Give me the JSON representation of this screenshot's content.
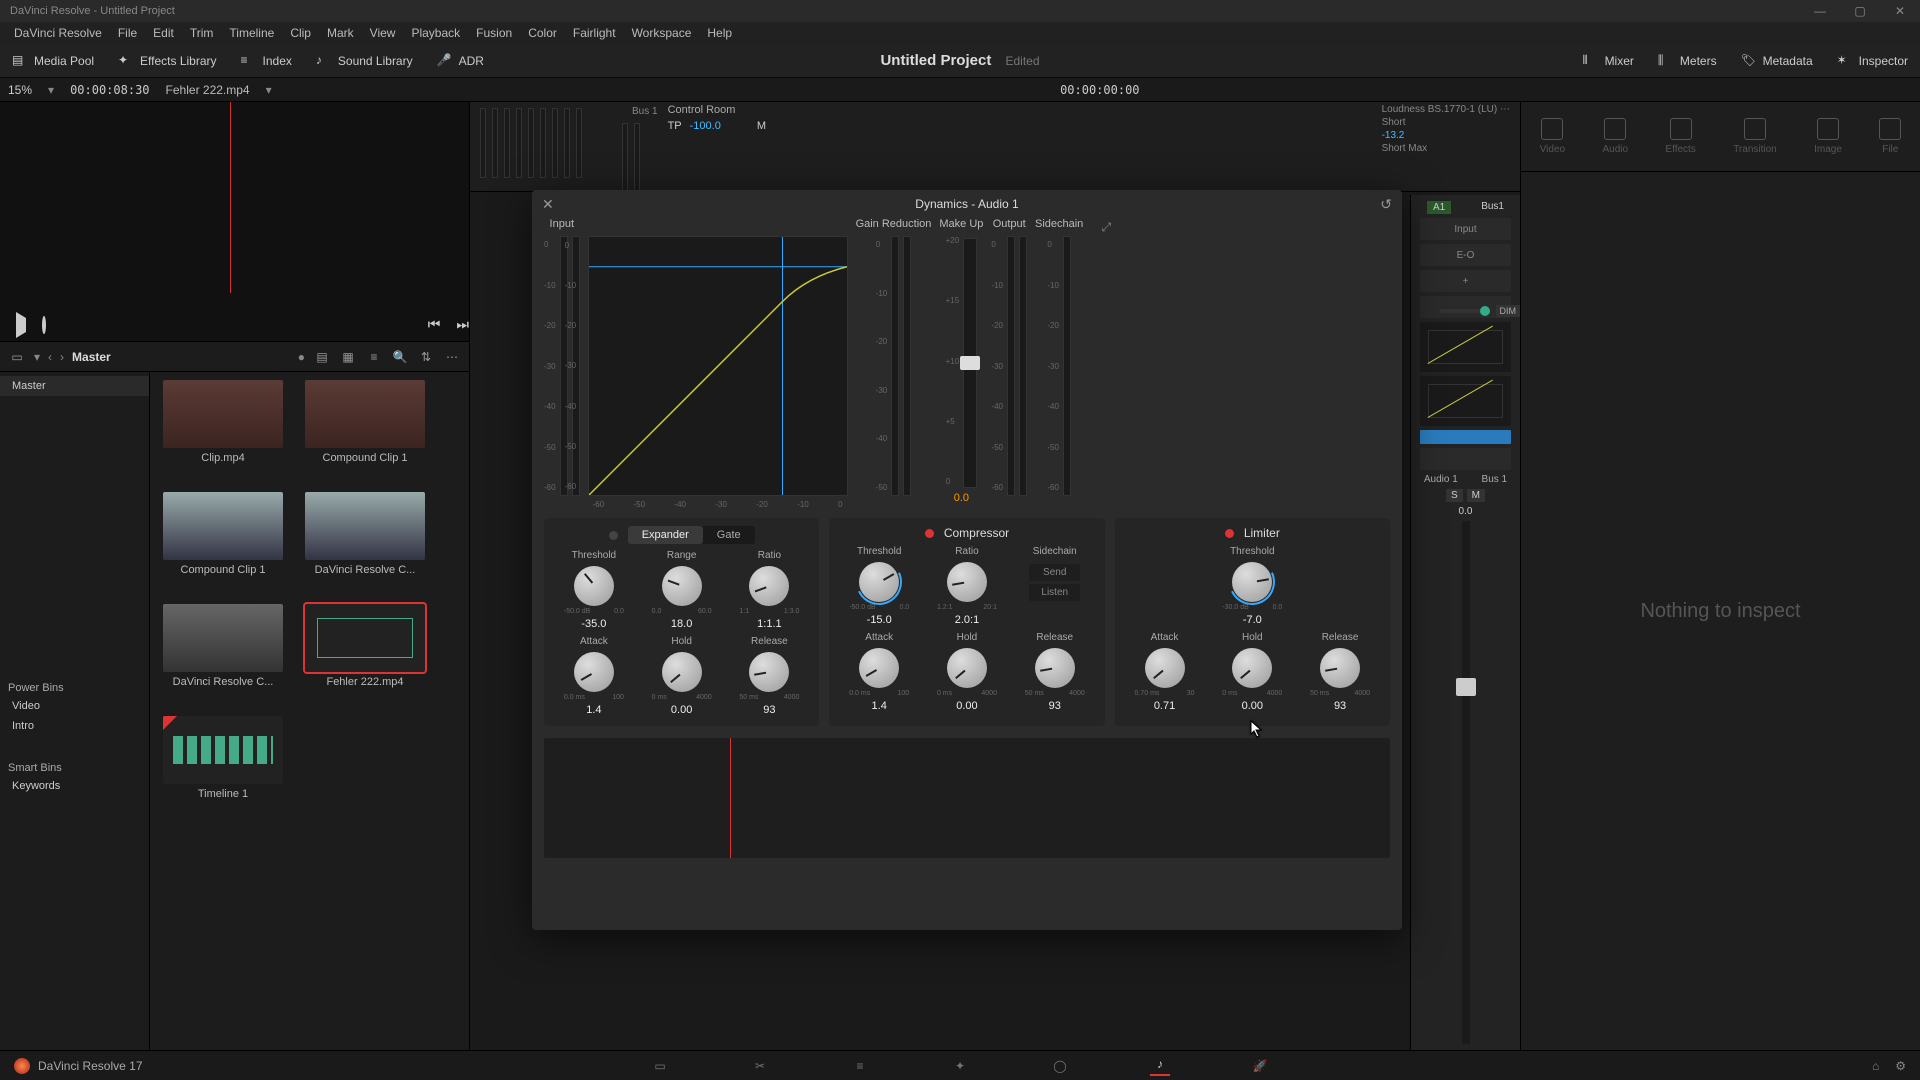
{
  "window_title": "DaVinci Resolve - Untitled Project",
  "menu": [
    "DaVinci Resolve",
    "File",
    "Edit",
    "Trim",
    "Timeline",
    "Clip",
    "Mark",
    "View",
    "Playback",
    "Fusion",
    "Color",
    "Fairlight",
    "Workspace",
    "Help"
  ],
  "toolbar": {
    "media_pool": "Media Pool",
    "effects": "Effects Library",
    "index": "Index",
    "sound": "Sound Library",
    "adr": "ADR",
    "mixer": "Mixer",
    "meters": "Meters",
    "metadata": "Metadata",
    "inspector": "Inspector"
  },
  "project": {
    "title": "Untitled Project",
    "edited": "Edited"
  },
  "strip": {
    "zoom": "15%",
    "tc1": "00:00:08:30",
    "clip": "Fehler 222.mp4",
    "tc2": "00:00:00:00"
  },
  "control_room": "Control Room",
  "loudness": {
    "label": "Loudness",
    "std": "BS.1770-1 (LU)",
    "tp_lbl": "TP",
    "tp_val": "-100.0",
    "m": "M",
    "short_lbl": "Short",
    "short_val": "-13.2",
    "shortmax": "Short Max"
  },
  "pool": {
    "crumb": "Master",
    "master": "Master",
    "power": "Power Bins",
    "video": "Video",
    "intro": "Intro",
    "smart": "Smart Bins",
    "keywords": "Keywords",
    "items": [
      {
        "label": "Clip.mp4",
        "kind": "people"
      },
      {
        "label": "Compound Clip 1",
        "kind": "people"
      },
      {
        "label": "Compound Clip 1",
        "kind": "lake"
      },
      {
        "label": "DaVinci Resolve C...",
        "kind": "lake"
      },
      {
        "label": "DaVinci Resolve C...",
        "kind": "road"
      },
      {
        "label": "Fehler 222.mp4",
        "kind": "ui",
        "selected": true
      },
      {
        "label": "Timeline 1",
        "kind": "tl",
        "flag": true
      }
    ]
  },
  "inspector": {
    "tabs": [
      "Video",
      "Audio",
      "Effects",
      "Transition",
      "Image",
      "File"
    ],
    "nothing": "Nothing to inspect"
  },
  "mixer": {
    "a1": "A1",
    "bus1": "Bus1",
    "input": "Input",
    "eo": "E-O",
    "plus": "+",
    "name": "Audio 1",
    "busout": "Bus 1",
    "zero": "0.0",
    "dim": "DIM"
  },
  "dialog": {
    "title": "Dynamics - Audio 1",
    "headers": {
      "input": "Input",
      "gr": "Gain Reduction",
      "makeup": "Make Up",
      "output": "Output",
      "sidechain": "Sidechain"
    },
    "makeup_val": "0.0",
    "db_scale": [
      "0",
      "-10",
      "-20",
      "-30",
      "-40",
      "-50",
      "-60"
    ],
    "makeup_ticks": [
      "+20",
      "+15",
      "+10",
      "+5",
      "0"
    ],
    "gr_ticks": [
      "0",
      "-10",
      "-20",
      "-30",
      "-40",
      "-50"
    ],
    "curve_ticks": [
      "-60",
      "-50",
      "-40",
      "-30",
      "-20",
      "-10",
      "0"
    ],
    "expander": {
      "name_exp": "Expander",
      "name_gate": "Gate",
      "active": false,
      "threshold": {
        "label": "Threshold",
        "range": [
          "-50.0 dB",
          "0.0"
        ],
        "val": "-35.0"
      },
      "range": {
        "label": "Range",
        "range": [
          "0.0",
          "60.0"
        ],
        "val": "18.0"
      },
      "ratio": {
        "label": "Ratio",
        "range": [
          "1:1",
          "1:3.0"
        ],
        "val": "1:1.1"
      },
      "attack": {
        "label": "Attack",
        "range": [
          "0.0 ms",
          "100"
        ],
        "val": "1.4"
      },
      "hold": {
        "label": "Hold",
        "range": [
          "0 ms",
          "4000"
        ],
        "val": "0.00"
      },
      "release": {
        "label": "Release",
        "range": [
          "50 ms",
          "4000"
        ],
        "val": "93"
      }
    },
    "compressor": {
      "name": "Compressor",
      "active": true,
      "threshold": {
        "label": "Threshold",
        "range": [
          "-50.0 dB",
          "0.0"
        ],
        "val": "-15.0"
      },
      "ratio": {
        "label": "Ratio",
        "range": [
          "1.2:1",
          "20:1"
        ],
        "val": "2.0:1"
      },
      "sidechain": {
        "label": "Sidechain",
        "send": "Send",
        "listen": "Listen"
      },
      "attack": {
        "label": "Attack",
        "range": [
          "0.0 ms",
          "100"
        ],
        "val": "1.4"
      },
      "hold": {
        "label": "Hold",
        "range": [
          "0 ms",
          "4000"
        ],
        "val": "0.00"
      },
      "release": {
        "label": "Release",
        "range": [
          "50 ms",
          "4000"
        ],
        "val": "93"
      }
    },
    "limiter": {
      "name": "Limiter",
      "active": true,
      "threshold": {
        "label": "Threshold",
        "range": [
          "-30.0 dB",
          "0.0"
        ],
        "val": "-7.0"
      },
      "attack": {
        "label": "Attack",
        "range": [
          "0.70 ms",
          "30"
        ],
        "val": "0.71"
      },
      "hold": {
        "label": "Hold",
        "range": [
          "0 ms",
          "4000"
        ],
        "val": "0.00"
      },
      "release": {
        "label": "Release",
        "range": [
          "50 ms",
          "4000"
        ],
        "val": "93"
      }
    }
  },
  "app_footer": "DaVinci Resolve 17"
}
